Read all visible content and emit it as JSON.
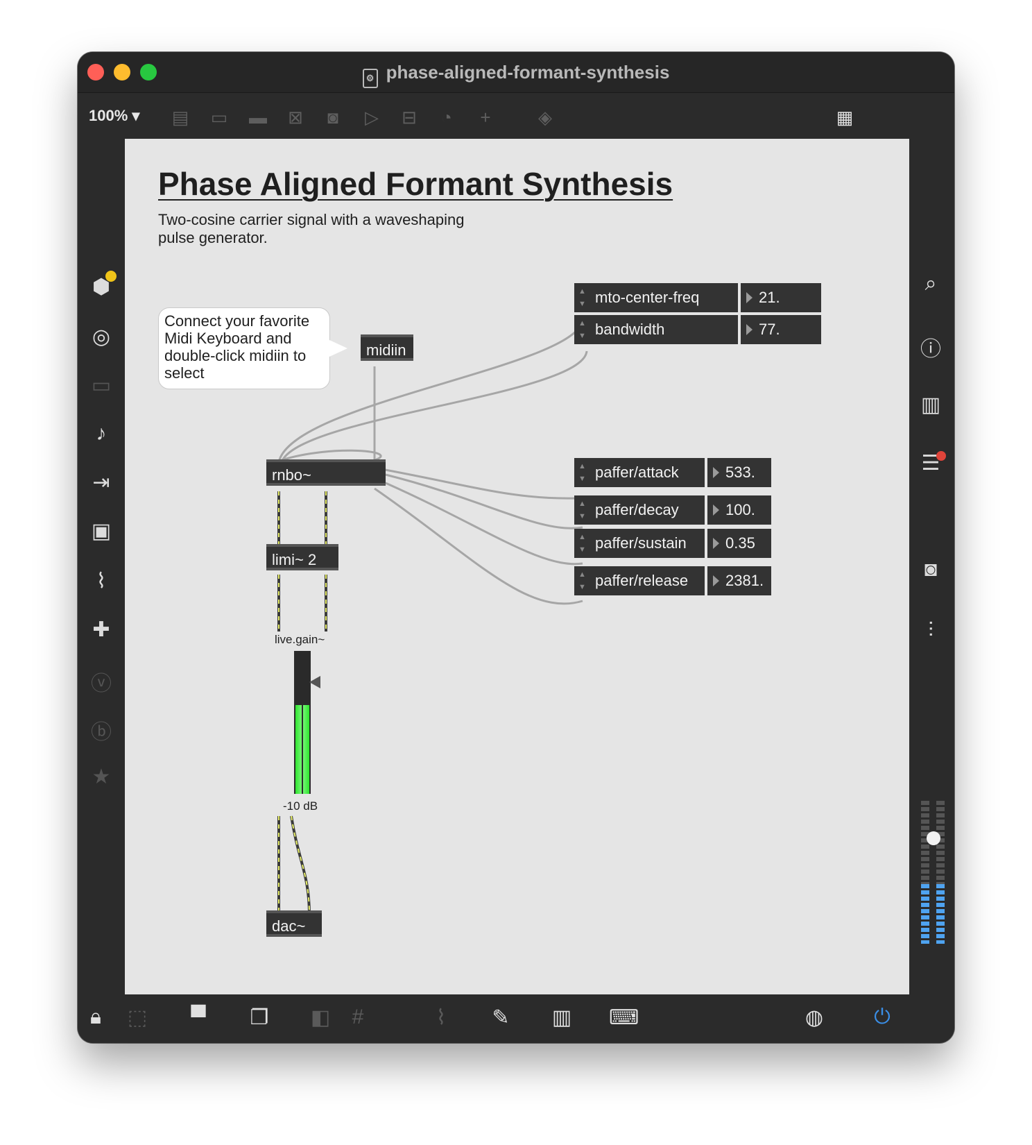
{
  "window": {
    "title": "phase-aligned-formant-synthesis"
  },
  "toolbar": {
    "zoom": "100% ▾"
  },
  "patch": {
    "title": "Phase Aligned Formant Synthesis",
    "subtitle_line1": "Two-cosine carrier signal with a waveshaping",
    "subtitle_line2": "pulse generator.",
    "comment": [
      "Connect your favorite",
      "Midi Keyboard and",
      "double-click midiin to",
      "select"
    ],
    "objects": {
      "midiin": "midiin",
      "rnbo": "rnbo~",
      "limi": "limi~ 2",
      "dac": "dac~"
    },
    "gain": {
      "label": "live.gain~",
      "value": "-10 dB",
      "level": 0.62
    },
    "params": [
      {
        "name": "mto-center-freq",
        "value": "21."
      },
      {
        "name": "bandwidth",
        "value": "77."
      },
      {
        "name": "paffer/attack",
        "value": "533."
      },
      {
        "name": "paffer/decay",
        "value": "100."
      },
      {
        "name": "paffer/sustain",
        "value": "0.35"
      },
      {
        "name": "paffer/release",
        "value": "2381."
      }
    ]
  },
  "colors": {
    "close": "#ff5f57",
    "minimize": "#febc2e",
    "zoom": "#28c840",
    "meter": "#3ddc3d",
    "audio_on": "#3a8ee6"
  }
}
